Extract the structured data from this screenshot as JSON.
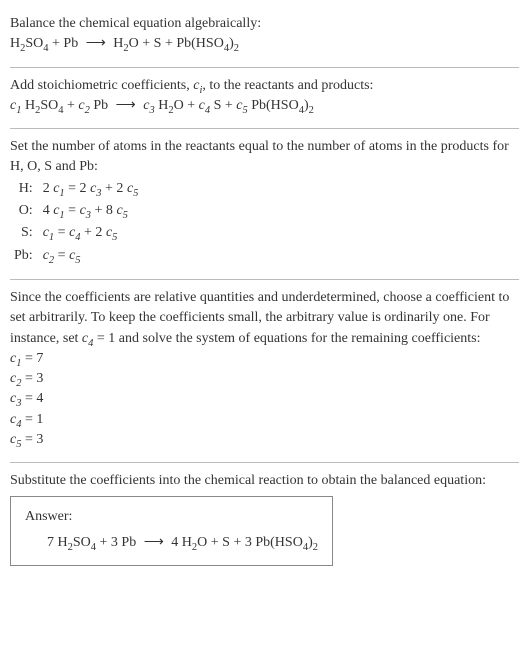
{
  "s1": {
    "line1": "Balance the chemical equation algebraically:",
    "eq_lhs1": "H",
    "eq_lhs1_sub": "2",
    "eq_lhs2": "SO",
    "eq_lhs2_sub": "4",
    "plus1": " + Pb ",
    "arrow": "⟶",
    "rhs1": " H",
    "rhs1_sub": "2",
    "rhs2": "O + S + Pb(HSO",
    "rhs2_sub": "4",
    "rhs3": ")",
    "rhs3_sub": "2"
  },
  "s2": {
    "line1a": "Add stoichiometric coefficients, ",
    "ci": "c",
    "ci_sub": "i",
    "line1b": ", to the reactants and products:",
    "c1": "c",
    "c1s": "1",
    "sp1": " H",
    "sp1s": "2",
    "sp1b": "SO",
    "sp1bs": "4",
    "plus1": " + ",
    "c2": "c",
    "c2s": "2",
    "sp2": " Pb ",
    "arrow": "⟶",
    "c3": " c",
    "c3s": "3",
    "sp3": " H",
    "sp3s": "2",
    "sp3b": "O + ",
    "c4": "c",
    "c4s": "4",
    "sp4": " S + ",
    "c5": "c",
    "c5s": "5",
    "sp5": " Pb(HSO",
    "sp5s": "4",
    "sp5b": ")",
    "sp5bs": "2"
  },
  "s3": {
    "intro": "Set the number of atoms in the reactants equal to the number of atoms in the products for H, O, S and Pb:",
    "rows": [
      {
        "lbl": "H:",
        "lhs_a": "2 ",
        "lhs_c": "c",
        "lhs_cs": "1",
        "eq": " = 2 ",
        "rhs_c1": "c",
        "rhs_c1s": "3",
        "mid": " + 2 ",
        "rhs_c2": "c",
        "rhs_c2s": "5"
      },
      {
        "lbl": "O:",
        "lhs_a": "4 ",
        "lhs_c": "c",
        "lhs_cs": "1",
        "eq": " = ",
        "rhs_c1": "c",
        "rhs_c1s": "3",
        "mid": " + 8 ",
        "rhs_c2": "c",
        "rhs_c2s": "5"
      },
      {
        "lbl": "S:",
        "lhs_a": "",
        "lhs_c": "c",
        "lhs_cs": "1",
        "eq": " = ",
        "rhs_c1": "c",
        "rhs_c1s": "4",
        "mid": " + 2 ",
        "rhs_c2": "c",
        "rhs_c2s": "5"
      },
      {
        "lbl": "Pb:",
        "lhs_a": "",
        "lhs_c": "c",
        "lhs_cs": "2",
        "eq": " = ",
        "rhs_c1": "c",
        "rhs_c1s": "5",
        "mid": "",
        "rhs_c2": "",
        "rhs_c2s": ""
      }
    ]
  },
  "s4": {
    "intro_a": "Since the coefficients are relative quantities and underdetermined, choose a coefficient to set arbitrarily. To keep the coefficients small, the arbitrary value is ordinarily one. For instance, set ",
    "set_c": "c",
    "set_cs": "4",
    "set_eq": " = 1",
    "intro_b": " and solve the system of equations for the remaining coefficients:",
    "solns": [
      {
        "c": "c",
        "cs": "1",
        "eq": " = 7"
      },
      {
        "c": "c",
        "cs": "2",
        "eq": " = 3"
      },
      {
        "c": "c",
        "cs": "3",
        "eq": " = 4"
      },
      {
        "c": "c",
        "cs": "4",
        "eq": " = 1"
      },
      {
        "c": "c",
        "cs": "5",
        "eq": " = 3"
      }
    ]
  },
  "s5": {
    "intro": "Substitute the coefficients into the chemical reaction to obtain the balanced equation:",
    "answer_label": "Answer:",
    "eq_a": "7 H",
    "eq_as": "2",
    "eq_b": "SO",
    "eq_bs": "4",
    "plus1": " + 3 Pb ",
    "arrow": "⟶",
    "rhs_a": " 4 H",
    "rhs_as": "2",
    "rhs_b": "O + S + 3 Pb(HSO",
    "rhs_bs": "4",
    "rhs_c": ")",
    "rhs_cs": "2"
  }
}
